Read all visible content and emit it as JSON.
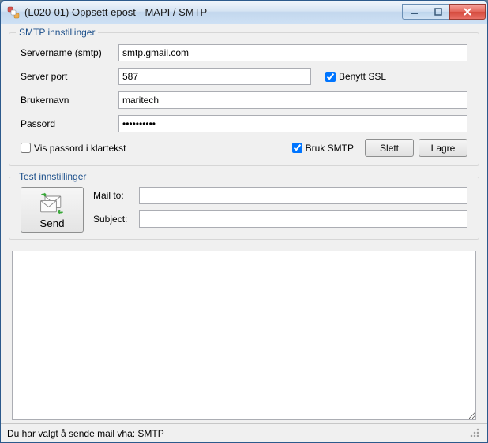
{
  "window": {
    "title": "(L020-01) Oppsett epost - MAPI / SMTP"
  },
  "smtp": {
    "legend": "SMTP innstillinger",
    "servername_label": "Servername (smtp)",
    "servername_value": "smtp.gmail.com",
    "serverport_label": "Server port",
    "serverport_value": "587",
    "use_ssl_label": "Benytt SSL",
    "use_ssl_checked": true,
    "username_label": "Brukernavn",
    "username_value": "maritech",
    "password_label": "Passord",
    "password_value": "••••••••••",
    "show_plaintext_label": "Vis passord i klartekst",
    "show_plaintext_checked": false,
    "use_smtp_label": "Bruk SMTP",
    "use_smtp_checked": true,
    "delete_button": "Slett",
    "save_button": "Lagre"
  },
  "test": {
    "legend": "Test innstillinger",
    "send_button": "Send",
    "mailto_label": "Mail to:",
    "mailto_value": "",
    "subject_label": "Subject:",
    "subject_value": "",
    "message_value": ""
  },
  "status": {
    "text": "Du har valgt å sende mail vha: SMTP"
  }
}
